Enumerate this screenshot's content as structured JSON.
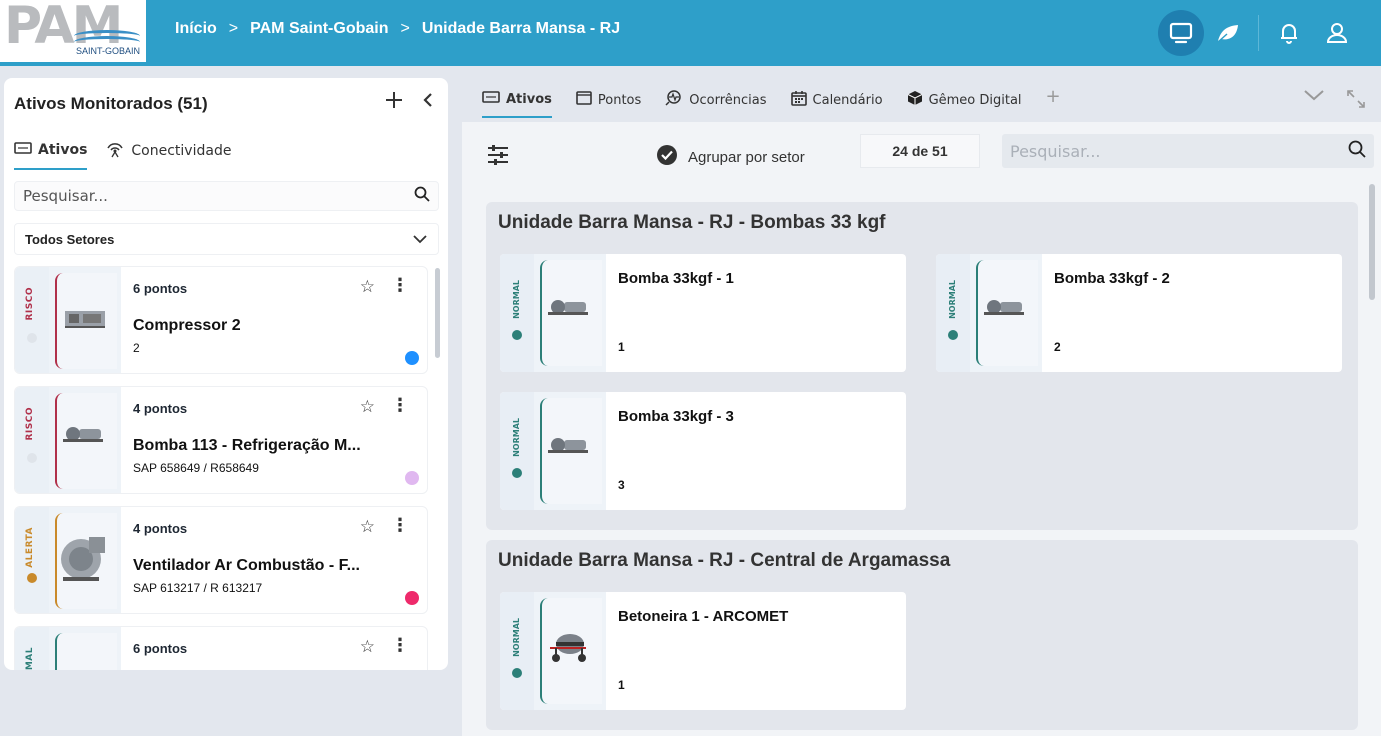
{
  "app": {
    "logo_text": "PAM",
    "logo_sub": "SAINT-GOBAIN"
  },
  "breadcrumb": {
    "items": [
      "Início",
      "PAM Saint-Gobain",
      "Unidade Barra Mansa - RJ"
    ],
    "separator": ">"
  },
  "topbar": {
    "icons": [
      "monitor-icon",
      "leaf-icon",
      "bell-icon",
      "user-icon"
    ],
    "accent": "#2e9fc9"
  },
  "left_panel": {
    "title": "Ativos Monitorados (51)",
    "tabs": [
      {
        "label": "Ativos",
        "icon": "equipment-icon",
        "active": true
      },
      {
        "label": "Conectividade",
        "icon": "antenna-icon",
        "active": false
      }
    ],
    "search_placeholder": "Pesquisar...",
    "sector_select": "Todos Setores",
    "assets": [
      {
        "status": "RISCO",
        "status_color": "#b0304a",
        "points": "6 pontos",
        "name": "Compressor 2",
        "code": "2",
        "dot_color": "#1e90ff"
      },
      {
        "status": "RISCO",
        "status_color": "#b0304a",
        "points": "4 pontos",
        "name": "Bomba 113 - Refrigeração M...",
        "code": "SAP 658649 / R658649",
        "dot_color": "#e0b8f0"
      },
      {
        "status": "ALERTA",
        "status_color": "#c98a2b",
        "points": "4 pontos",
        "name": "Ventilador Ar Combustão - F...",
        "code": "SAP 613217 / R 613217",
        "dot_color": "#ee2a6b"
      },
      {
        "status": "NORMAL",
        "status_color": "#2c7f78",
        "points": "6 pontos",
        "name": "",
        "code": "",
        "dot_color": ""
      }
    ]
  },
  "right_panel": {
    "tabs": [
      {
        "label": "Ativos",
        "icon": "equipment-icon",
        "active": true
      },
      {
        "label": "Pontos",
        "icon": "square-icon",
        "active": false
      },
      {
        "label": "Ocorrências",
        "icon": "search-wave-icon",
        "active": false
      },
      {
        "label": "Calendário",
        "icon": "calendar-icon",
        "active": false
      },
      {
        "label": "Gêmeo Digital",
        "icon": "cube-icon",
        "active": false
      }
    ],
    "group_toggle": "Agrupar por setor",
    "count": "24 de 51",
    "search_placeholder": "Pesquisar...",
    "groups": [
      {
        "title": "Unidade Barra Mansa - RJ - Bombas 33 kgf",
        "cards": [
          {
            "status": "NORMAL",
            "name": "Bomba 33kgf - 1",
            "code": "1"
          },
          {
            "status": "NORMAL",
            "name": "Bomba 33kgf - 2",
            "code": "2"
          },
          {
            "status": "NORMAL",
            "name": "Bomba 33kgf - 3",
            "code": "3"
          }
        ]
      },
      {
        "title": "Unidade Barra Mansa - RJ - Central de Argamassa",
        "cards": [
          {
            "status": "NORMAL",
            "name": "Betoneira 1 - ARCOMET",
            "code": "1"
          }
        ]
      }
    ]
  }
}
